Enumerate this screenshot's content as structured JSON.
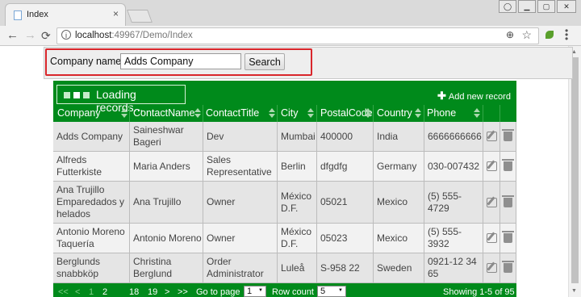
{
  "browser": {
    "tab_title": "Index",
    "tab_close": "×",
    "url_host": "localhost",
    "url_path": ":49967/Demo/Index"
  },
  "search": {
    "label": "Company name:",
    "value": "Adds Company",
    "button": "Search"
  },
  "table": {
    "loading_text": "Loading records...",
    "add_new_label": "Add new record",
    "columns": [
      "Company",
      "ContactName",
      "ContactTitle",
      "City",
      "PostalCode",
      "Country",
      "Phone"
    ],
    "rows": [
      [
        "Adds Company",
        "Saineshwar Bageri",
        "Dev",
        "Mumbai",
        "400000",
        "India",
        "6666666666"
      ],
      [
        "Alfreds Futterkiste",
        "Maria Anders",
        "Sales Representative",
        "Berlin",
        "dfgdfg",
        "Germany",
        "030-007432"
      ],
      [
        "Ana Trujillo Emparedados y helados",
        "Ana Trujillo",
        "Owner",
        "México D.F.",
        "05021",
        "Mexico",
        "(5) 555-4729"
      ],
      [
        "Antonio Moreno Taquería",
        "Antonio Moreno",
        "Owner",
        "México D.F.",
        "05023",
        "Mexico",
        "(5) 555-3932"
      ],
      [
        "Berglunds snabbköp",
        "Christina Berglund",
        "Order Administrator",
        "Luleå",
        "S-958 22",
        "Sweden",
        "0921-12 34 65"
      ]
    ]
  },
  "pager": {
    "first": "<<",
    "prev": "<",
    "pages": [
      "1",
      "2",
      "18",
      "19"
    ],
    "next": ">",
    "last": ">>",
    "goto_label": "Go to page",
    "goto_value": "1",
    "rowcount_label": "Row count",
    "rowcount_value": "5",
    "info": "Showing 1-5 of 95"
  },
  "colors": {
    "table_green": "#008a1b",
    "highlight_red": "#d9262b"
  }
}
